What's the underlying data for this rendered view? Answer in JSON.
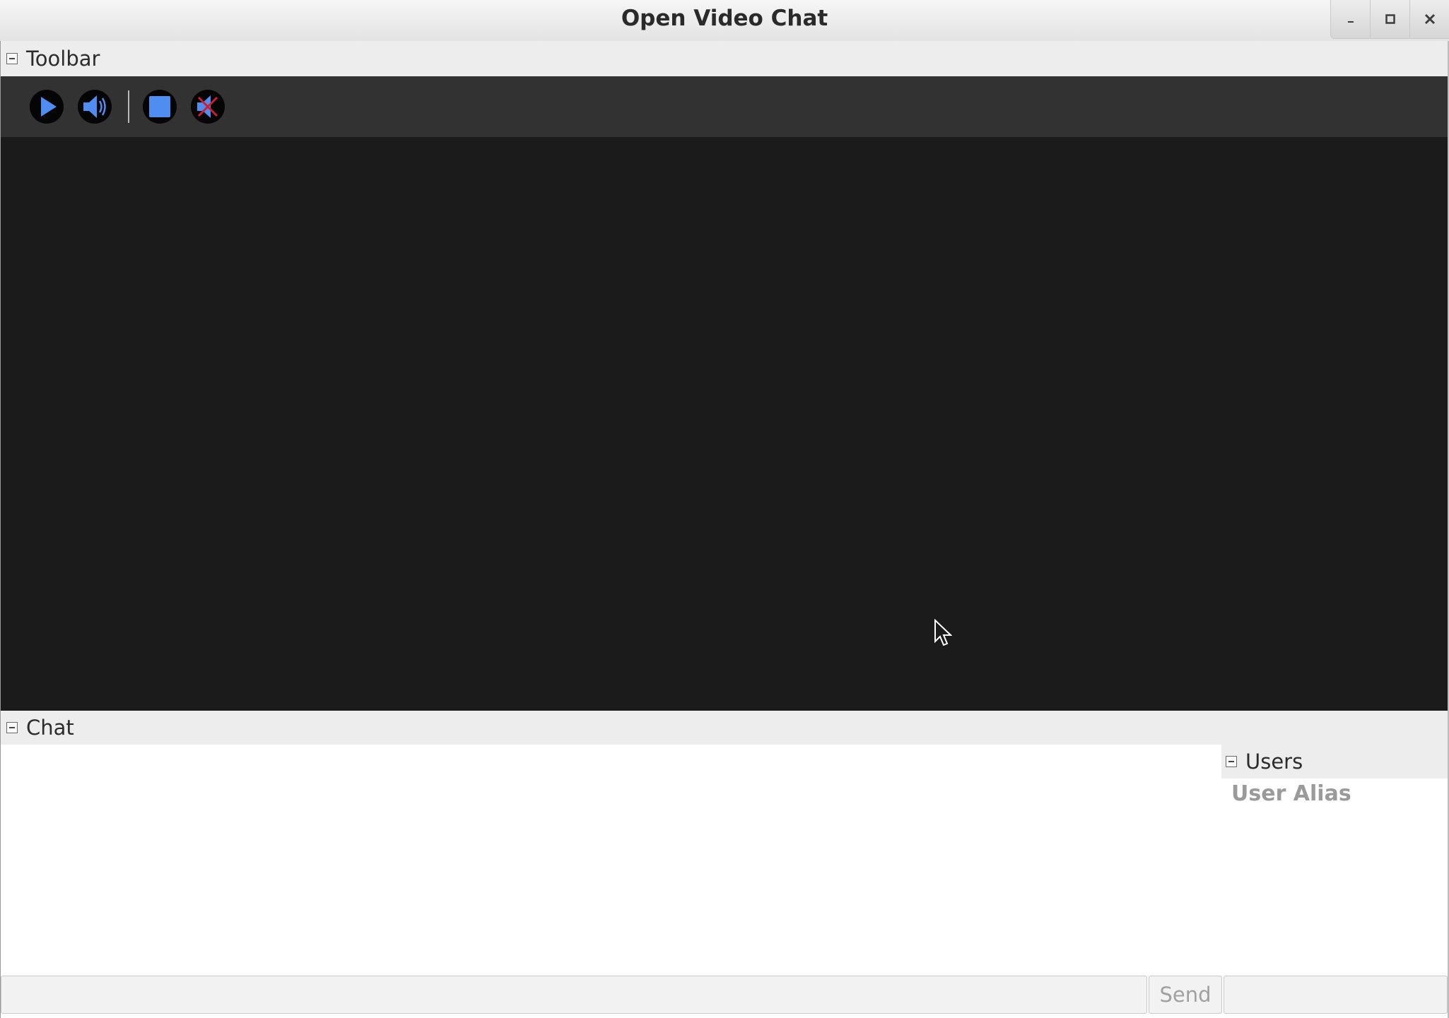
{
  "window": {
    "title": "Open Video Chat",
    "controls": {
      "minimize": "minimize-icon",
      "maximize": "maximize-icon",
      "close": "close-icon"
    }
  },
  "toolbar": {
    "header": "Toolbar",
    "buttons": [
      {
        "icon": "play-icon",
        "color": "#4f8ef0"
      },
      {
        "icon": "volume-icon",
        "color": "#4f8ef0"
      },
      {
        "icon": "stop-icon",
        "color": "#4f8ef0"
      },
      {
        "icon": "mute-icon",
        "color": "#4f8ef0"
      }
    ]
  },
  "chat": {
    "header": "Chat",
    "input_value": "",
    "send_label": "Send"
  },
  "users": {
    "header": "Users",
    "list": [
      "User Alias"
    ],
    "input_value": ""
  },
  "colors": {
    "accent": "#4f8ef0",
    "video_background": "#1b1b1b",
    "toolbar_background": "#323232"
  }
}
